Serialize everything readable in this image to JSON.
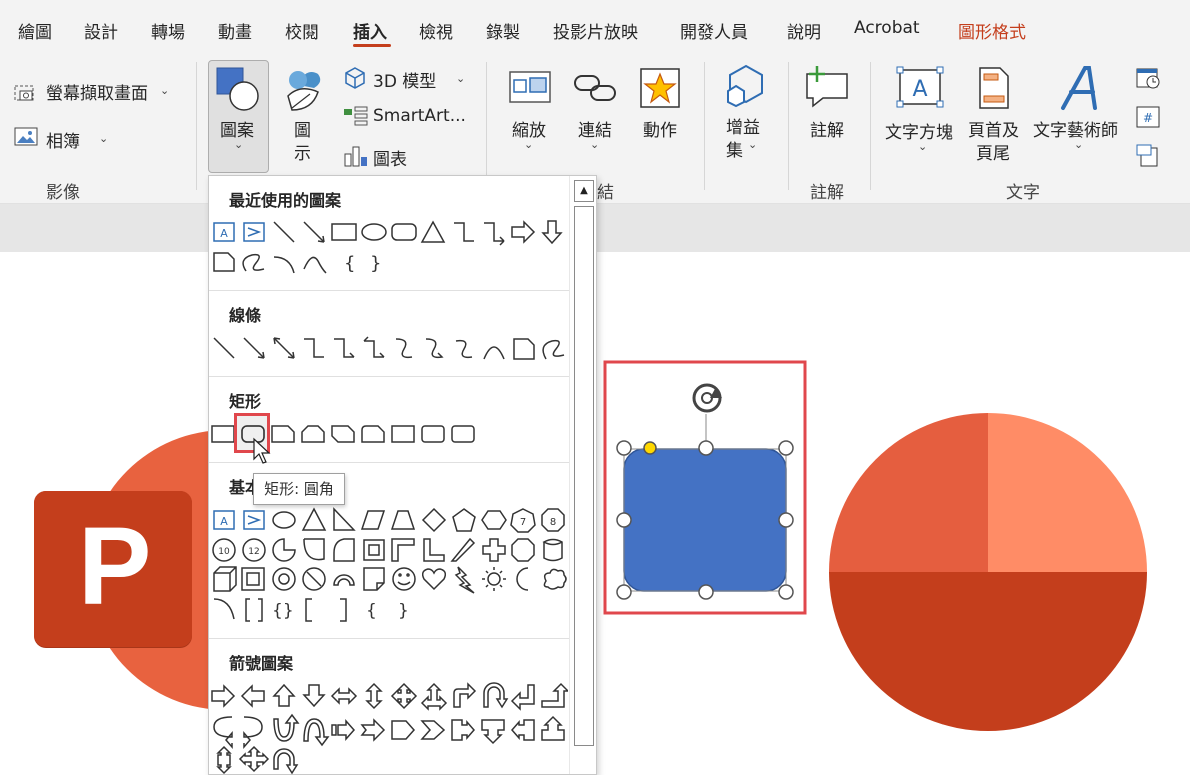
{
  "tabs": [
    {
      "label": "繪圖"
    },
    {
      "label": "設計"
    },
    {
      "label": "轉場"
    },
    {
      "label": "動畫"
    },
    {
      "label": "校閱"
    },
    {
      "label": "插入",
      "active": true
    },
    {
      "label": "檢視"
    },
    {
      "label": "錄製"
    },
    {
      "label": "投影片放映"
    },
    {
      "label": "開發人員"
    },
    {
      "label": "說明"
    },
    {
      "label": "Acrobat"
    },
    {
      "label": "圖形格式",
      "contextual": true
    }
  ],
  "ribbon": {
    "images": {
      "screenshot_label": "螢幕擷取畫面",
      "album_label": "相簿",
      "group_label": "影像"
    },
    "illustrations": {
      "shapes_label": "圖案",
      "icons_label_1": "圖",
      "icons_label_2": "示",
      "model3d_label": "3D 模型",
      "smartart_label": "SmartArt...",
      "chart_label": "圖表"
    },
    "links": {
      "zoom_label": "縮放",
      "link_label": "連結",
      "action_label": "動作",
      "group_label_partial": "結"
    },
    "addins": {
      "label_1": "增益",
      "label_2": "集"
    },
    "comments": {
      "comment_label": "註解",
      "group_label": "註解"
    },
    "text": {
      "textbox_label": "文字方塊",
      "header_label_1": "頁首及",
      "header_label_2": "頁尾",
      "wordart_label": "文字藝術師",
      "group_label": "文字"
    }
  },
  "gallery": {
    "sections": [
      {
        "title": "最近使用的圖案"
      },
      {
        "title": "線條"
      },
      {
        "title": "矩形"
      },
      {
        "title": "基本"
      },
      {
        "title": "箭號圖案"
      }
    ],
    "tooltip": "矩形: 圓角",
    "hovered_shape": "rounded-rectangle"
  },
  "slide": {
    "logo_letter": "P",
    "selected_shape_fill": "#4472c4",
    "pie_colors": [
      "#ff8c66",
      "#c43e1c",
      "#e55e3f"
    ]
  },
  "colors": {
    "accent": "#c43e1c",
    "highlight_box": "#e0474c",
    "adjust_handle": "#ffd800"
  }
}
